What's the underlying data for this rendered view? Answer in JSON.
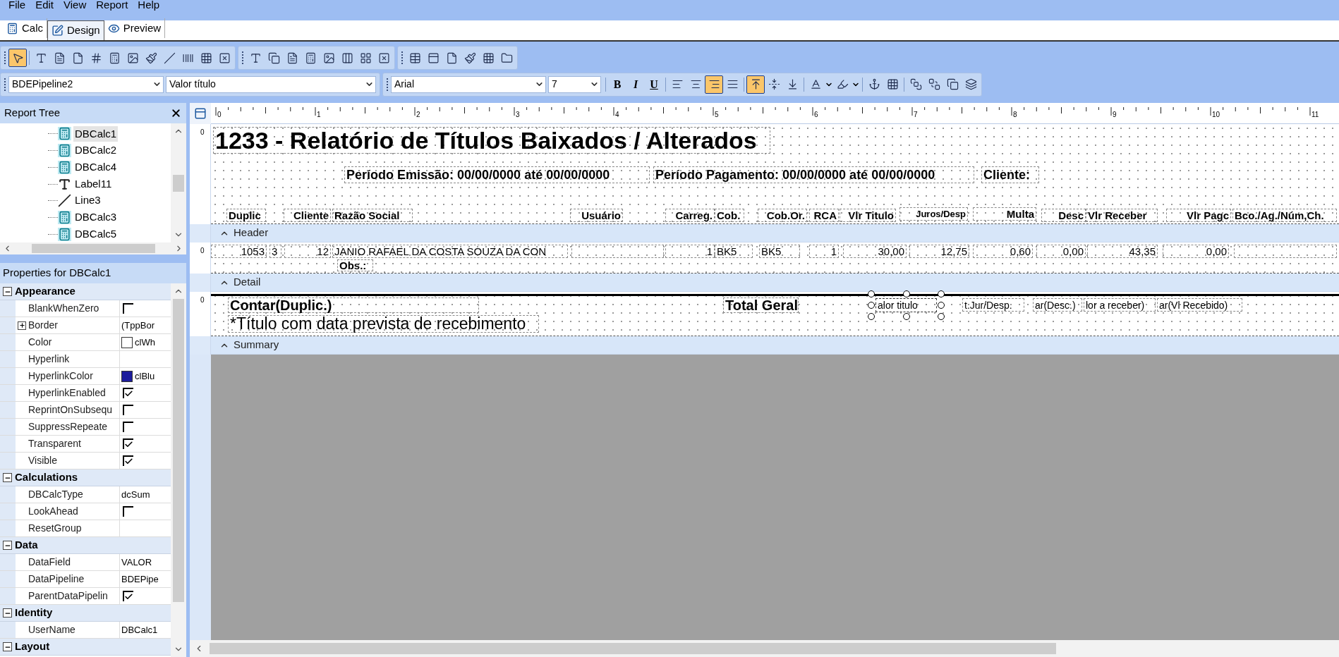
{
  "menu": [
    "File",
    "Edit",
    "View",
    "Report",
    "Help"
  ],
  "tabs": [
    {
      "label": "Calc",
      "selected": false
    },
    {
      "label": "Design",
      "selected": true
    },
    {
      "label": "Preview",
      "selected": false
    }
  ],
  "component_toolbar": {
    "groups": [
      [
        {
          "selected": true
        },
        {
          "selected": false
        },
        {
          "selected": false
        },
        {
          "selected": false
        },
        {
          "selected": false
        },
        {
          "selected": false
        },
        {
          "selected": false
        },
        {
          "selected": false
        },
        {
          "selected": false
        },
        {
          "selected": false
        },
        {
          "selected": false
        },
        {
          "selected": false
        }
      ],
      [
        {
          "selected": false
        },
        {
          "selected": false
        },
        {
          "selected": false
        },
        {
          "selected": false
        },
        {
          "selected": false
        },
        {
          "selected": false
        },
        {
          "selected": false
        },
        {
          "selected": false
        }
      ],
      [
        {
          "selected": false
        },
        {
          "selected": false
        },
        {
          "selected": false
        },
        {
          "selected": false
        },
        {
          "selected": false
        },
        {
          "selected": false
        }
      ]
    ]
  },
  "format_toolbar": {
    "pipeline": "BDEPipeline2",
    "field": "Valor título",
    "font": "Arial",
    "size": "7",
    "styles": [
      {
        "label": "B",
        "selected": false
      },
      {
        "label": "I",
        "selected": false
      },
      {
        "label": "U",
        "selected": false
      }
    ],
    "align": [
      {
        "selected": false
      },
      {
        "selected": false
      },
      {
        "selected": true
      },
      {
        "selected": false
      }
    ],
    "valign": [
      {
        "selected": true
      },
      {
        "selected": false
      },
      {
        "selected": false
      }
    ]
  },
  "report_tree": {
    "title": "Report Tree",
    "items": [
      {
        "label": "DBCalc1",
        "kind": "calc",
        "selected": true
      },
      {
        "label": "DBCalc2",
        "kind": "calc",
        "selected": false
      },
      {
        "label": "DBCalc4",
        "kind": "calc",
        "selected": false
      },
      {
        "label": "Label11",
        "kind": "label",
        "selected": false
      },
      {
        "label": "Line3",
        "kind": "line",
        "selected": false
      },
      {
        "label": "DBCalc3",
        "kind": "calc",
        "selected": false
      },
      {
        "label": "DBCalc5",
        "kind": "calc",
        "selected": false
      }
    ]
  },
  "properties": {
    "title": "Properties for DBCalc1",
    "categories": [
      {
        "name": "Appearance",
        "expanded": true,
        "rows": [
          {
            "name": "BlankWhenZero",
            "kind": "checkbox",
            "checked": false
          },
          {
            "name": "Border",
            "kind": "expandable",
            "expanded": false,
            "value": "(TppBor"
          },
          {
            "name": "Color",
            "kind": "color",
            "color": "#ffffff",
            "value": "clWh"
          },
          {
            "name": "Hyperlink",
            "kind": "text"
          },
          {
            "name": "HyperlinkColor",
            "kind": "color",
            "color": "#1c1c9c",
            "value": "clBlu"
          },
          {
            "name": "HyperlinkEnabled",
            "kind": "checkbox",
            "checked": true
          },
          {
            "name": "ReprintOnSubsequ",
            "kind": "checkbox",
            "checked": false
          },
          {
            "name": "SuppressRepeate",
            "kind": "checkbox",
            "checked": false
          },
          {
            "name": "Transparent",
            "kind": "checkbox",
            "checked": true
          },
          {
            "name": "Visible",
            "kind": "checkbox",
            "checked": true
          }
        ]
      },
      {
        "name": "Calculations",
        "expanded": true,
        "rows": [
          {
            "name": "DBCalcType",
            "kind": "text",
            "value": "dcSum"
          },
          {
            "name": "LookAhead",
            "kind": "checkbox",
            "checked": false
          },
          {
            "name": "ResetGroup",
            "kind": "text"
          }
        ]
      },
      {
        "name": "Data",
        "expanded": true,
        "rows": [
          {
            "name": "DataField",
            "kind": "text",
            "value": "VALOR"
          },
          {
            "name": "DataPipeline",
            "kind": "text",
            "value": "BDEPipe"
          },
          {
            "name": "ParentDataPipelin",
            "kind": "checkbox",
            "checked": true
          }
        ]
      },
      {
        "name": "Identity",
        "expanded": true,
        "rows": [
          {
            "name": "UserName",
            "kind": "text",
            "value": "DBCalc1"
          }
        ]
      },
      {
        "name": "Layout",
        "expanded": true
      }
    ]
  },
  "ruler": [
    "0",
    "1",
    "2",
    "3",
    "4",
    "5",
    "6",
    "7",
    "8",
    "9",
    "10",
    "11"
  ],
  "bands": [
    {
      "name": "Header",
      "ruler_mark": "0",
      "items": [
        {
          "kind": "title",
          "text": "1233 - Relatório de Títulos Baixados / Alterados",
          "selected": false
        },
        {
          "kind": "subtitle",
          "text": "Período Emissão: 00/00/0000 até 00/00/0000",
          "selected": false
        },
        {
          "kind": "subtitle",
          "text": "Período Pagamento: 00/00/0000 até 00/00/0000",
          "selected": false
        },
        {
          "kind": "subtitle",
          "text": "Cliente:",
          "selected": false
        },
        {
          "kind": "column",
          "text": "Duplic",
          "selected": false
        },
        {
          "kind": "column",
          "text": "Cliente",
          "selected": false
        },
        {
          "kind": "column",
          "text": "Razão Social",
          "selected": false
        },
        {
          "kind": "column",
          "text": "Usuário",
          "selected": false
        },
        {
          "kind": "column",
          "text": "Carreg.",
          "selected": false
        },
        {
          "kind": "column",
          "text": "Cob.",
          "selected": false
        },
        {
          "kind": "column",
          "text": "Cob.Or.",
          "selected": false
        },
        {
          "kind": "column",
          "text": "RCA",
          "selected": false
        },
        {
          "kind": "column",
          "text": "Vlr Titulo",
          "selected": false
        },
        {
          "kind": "small",
          "text": "Juros/Desp",
          "selected": false
        },
        {
          "kind": "column",
          "text": "Multa",
          "selected": false
        },
        {
          "kind": "column",
          "text": "Desc",
          "selected": false
        },
        {
          "kind": "column",
          "text": "Vlr Receber",
          "selected": false
        },
        {
          "kind": "column",
          "text": "Vlr Pagc",
          "selected": false
        },
        {
          "kind": "column",
          "text": "Bco./Ag./Núm,Ch.",
          "selected": false
        }
      ]
    },
    {
      "name": "Detail",
      "ruler_mark": "0",
      "items": [
        {
          "kind": "value",
          "text": "1053",
          "selected": false
        },
        {
          "kind": "value",
          "text": "3",
          "selected": false
        },
        {
          "kind": "value",
          "text": "12",
          "selected": false
        },
        {
          "kind": "value",
          "text": "JANIO RAFAEL DA COSTA SOUZA DA CON",
          "selected": false
        },
        {
          "kind": "blank",
          "selected": false
        },
        {
          "kind": "value",
          "text": "1",
          "selected": false
        },
        {
          "kind": "value",
          "text": "BK5",
          "selected": false
        },
        {
          "kind": "value",
          "text": "BK5",
          "selected": false
        },
        {
          "kind": "value",
          "text": "1",
          "selected": false
        },
        {
          "kind": "value",
          "text": "30,00",
          "selected": false
        },
        {
          "kind": "value",
          "text": "12,75",
          "selected": false
        },
        {
          "kind": "value",
          "text": "0,60",
          "selected": false
        },
        {
          "kind": "value",
          "text": "0,00",
          "selected": false
        },
        {
          "kind": "value",
          "text": "43,35",
          "selected": false
        },
        {
          "kind": "value",
          "text": "0,00",
          "selected": false
        },
        {
          "kind": "blank",
          "selected": false
        },
        {
          "kind": "column",
          "text": "Obs.:",
          "selected": false
        }
      ]
    },
    {
      "name": "Summary",
      "ruler_mark": "0",
      "items": [
        {
          "kind": "total",
          "text": "Contar(Duplic.)",
          "selected": false
        },
        {
          "kind": "total",
          "text": "Total Geral",
          "selected": false
        },
        {
          "kind": "calc",
          "text": "alor titulo",
          "selected": true
        },
        {
          "kind": "calc",
          "text": "t.Jur/Desp.",
          "selected": false
        },
        {
          "kind": "calc",
          "text": "ar(Desc.)",
          "selected": false
        },
        {
          "kind": "calc",
          "text": "lor a receber)",
          "selected": false
        },
        {
          "kind": "calc",
          "text": "ar(Vl Recebido)",
          "selected": false
        },
        {
          "kind": "note",
          "text": "*Título com data prevista  de recebimento",
          "selected": false
        }
      ]
    }
  ]
}
